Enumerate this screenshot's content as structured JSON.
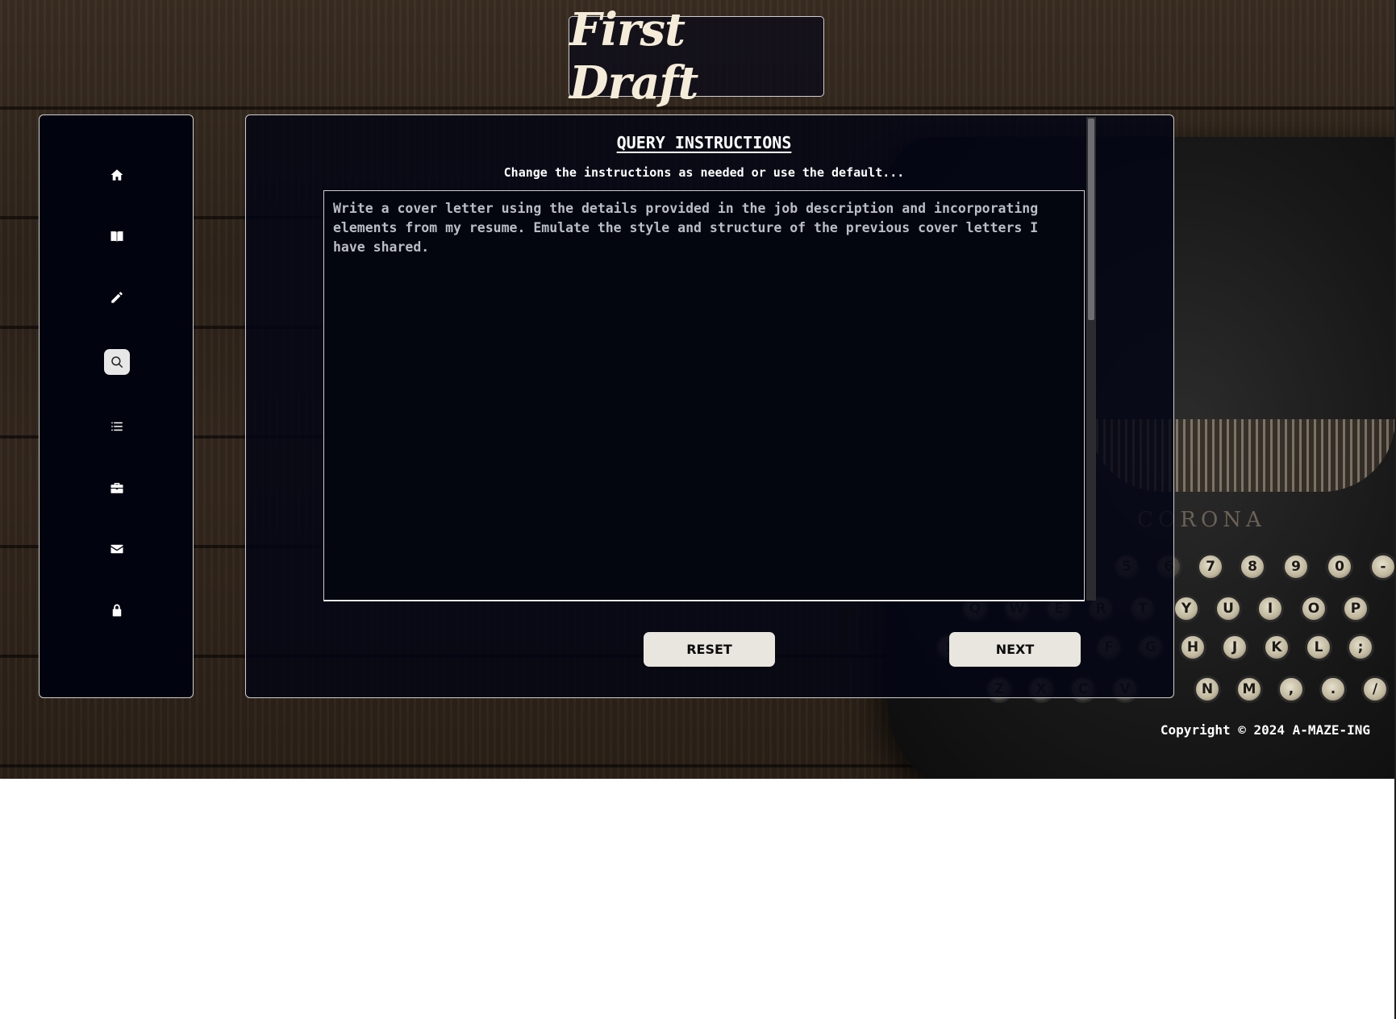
{
  "app": {
    "title": "First Draft"
  },
  "sidebar": {
    "items": [
      {
        "icon": "home-icon",
        "name": "sidebar-item-home"
      },
      {
        "icon": "book-icon",
        "name": "sidebar-item-book"
      },
      {
        "icon": "pencil-icon",
        "name": "sidebar-item-edit"
      },
      {
        "icon": "search-icon",
        "name": "sidebar-item-search",
        "active": true
      },
      {
        "icon": "list-icon",
        "name": "sidebar-item-list"
      },
      {
        "icon": "briefcase-icon",
        "name": "sidebar-item-briefcase"
      },
      {
        "icon": "envelope-icon",
        "name": "sidebar-item-mail"
      },
      {
        "icon": "lock-icon",
        "name": "sidebar-item-lock"
      }
    ]
  },
  "main": {
    "heading": "QUERY INSTRUCTIONS",
    "subheading": "Change the instructions as needed or use the default...",
    "instructions_value": "Write a cover letter using the details provided in the job description and incorporating elements from my resume. Emulate the style and structure of the previous cover letters I have shared.",
    "reset_label": "RESET",
    "next_label": "NEXT"
  },
  "footer": {
    "copyright": "Copyright © 2024 A-MAZE-ING"
  },
  "colors": {
    "panel_bg": "#02050f",
    "button_bg": "#e8e6df",
    "title_text": "#f4ecd8",
    "active_nav": "#e7e7e7"
  }
}
